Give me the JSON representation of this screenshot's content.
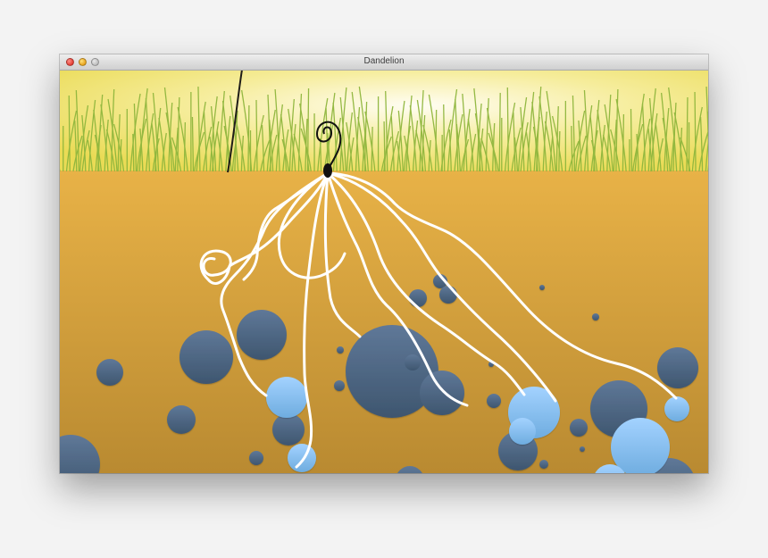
{
  "window": {
    "title": "Dandelion"
  },
  "scene": {
    "colors": {
      "sky_yellow": "#efe46a",
      "sky_center": "#fffdf0",
      "grass": "#8eb63e",
      "soil_top": "#e8b348",
      "soil_bottom": "#b98b32",
      "root": "#ffffff",
      "dark_bubble": "#4d6685",
      "light_bubble": "#86bff0",
      "seed": "#111111"
    },
    "icons": [
      "close-icon",
      "minimize-icon",
      "zoom-icon",
      "seed-icon"
    ]
  }
}
